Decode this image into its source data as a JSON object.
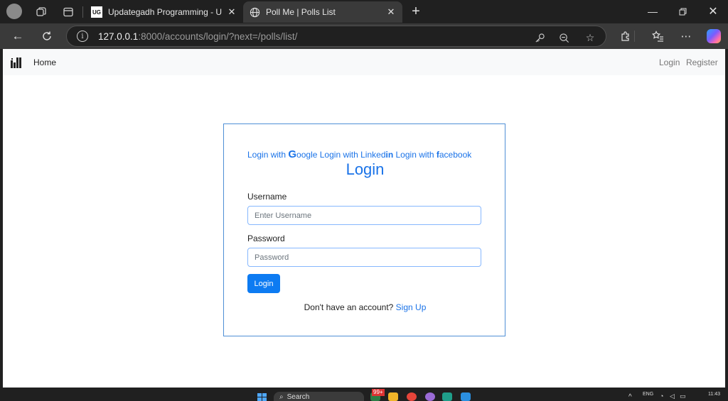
{
  "browser": {
    "tabs": [
      {
        "title": "Updategadh Programming - Upd",
        "favicon_text": "UG",
        "active": false
      },
      {
        "title": "Poll Me | Polls List",
        "active": true
      }
    ],
    "url": {
      "host": "127.0.0.1",
      "rest": ":8000/accounts/login/?next=/polls/list/"
    }
  },
  "site_nav": {
    "home": "Home",
    "login": "Login",
    "register": "Register"
  },
  "login_card": {
    "social": {
      "google_prefix": "Login with ",
      "google_g": "G",
      "google_rest": "oogle",
      "linkedin_prefix": " Login with Linked",
      "linkedin_in": "in",
      "facebook_prefix": " Login with ",
      "facebook_f": "f",
      "facebook_rest": "acebook"
    },
    "title": "Login",
    "username_label": "Username",
    "username_placeholder": "Enter Username",
    "password_label": "Password",
    "password_placeholder": "Password",
    "submit": "Login",
    "no_account_text": "Don't have an account? ",
    "signup_link": "Sign Up"
  },
  "taskbar": {
    "search": "Search",
    "badge": "99+",
    "lang": "ENG",
    "time": "11:43"
  },
  "colors": {
    "accent": "#1a73e8",
    "button": "#0d7bf2",
    "card_border": "#4f8fd6"
  }
}
